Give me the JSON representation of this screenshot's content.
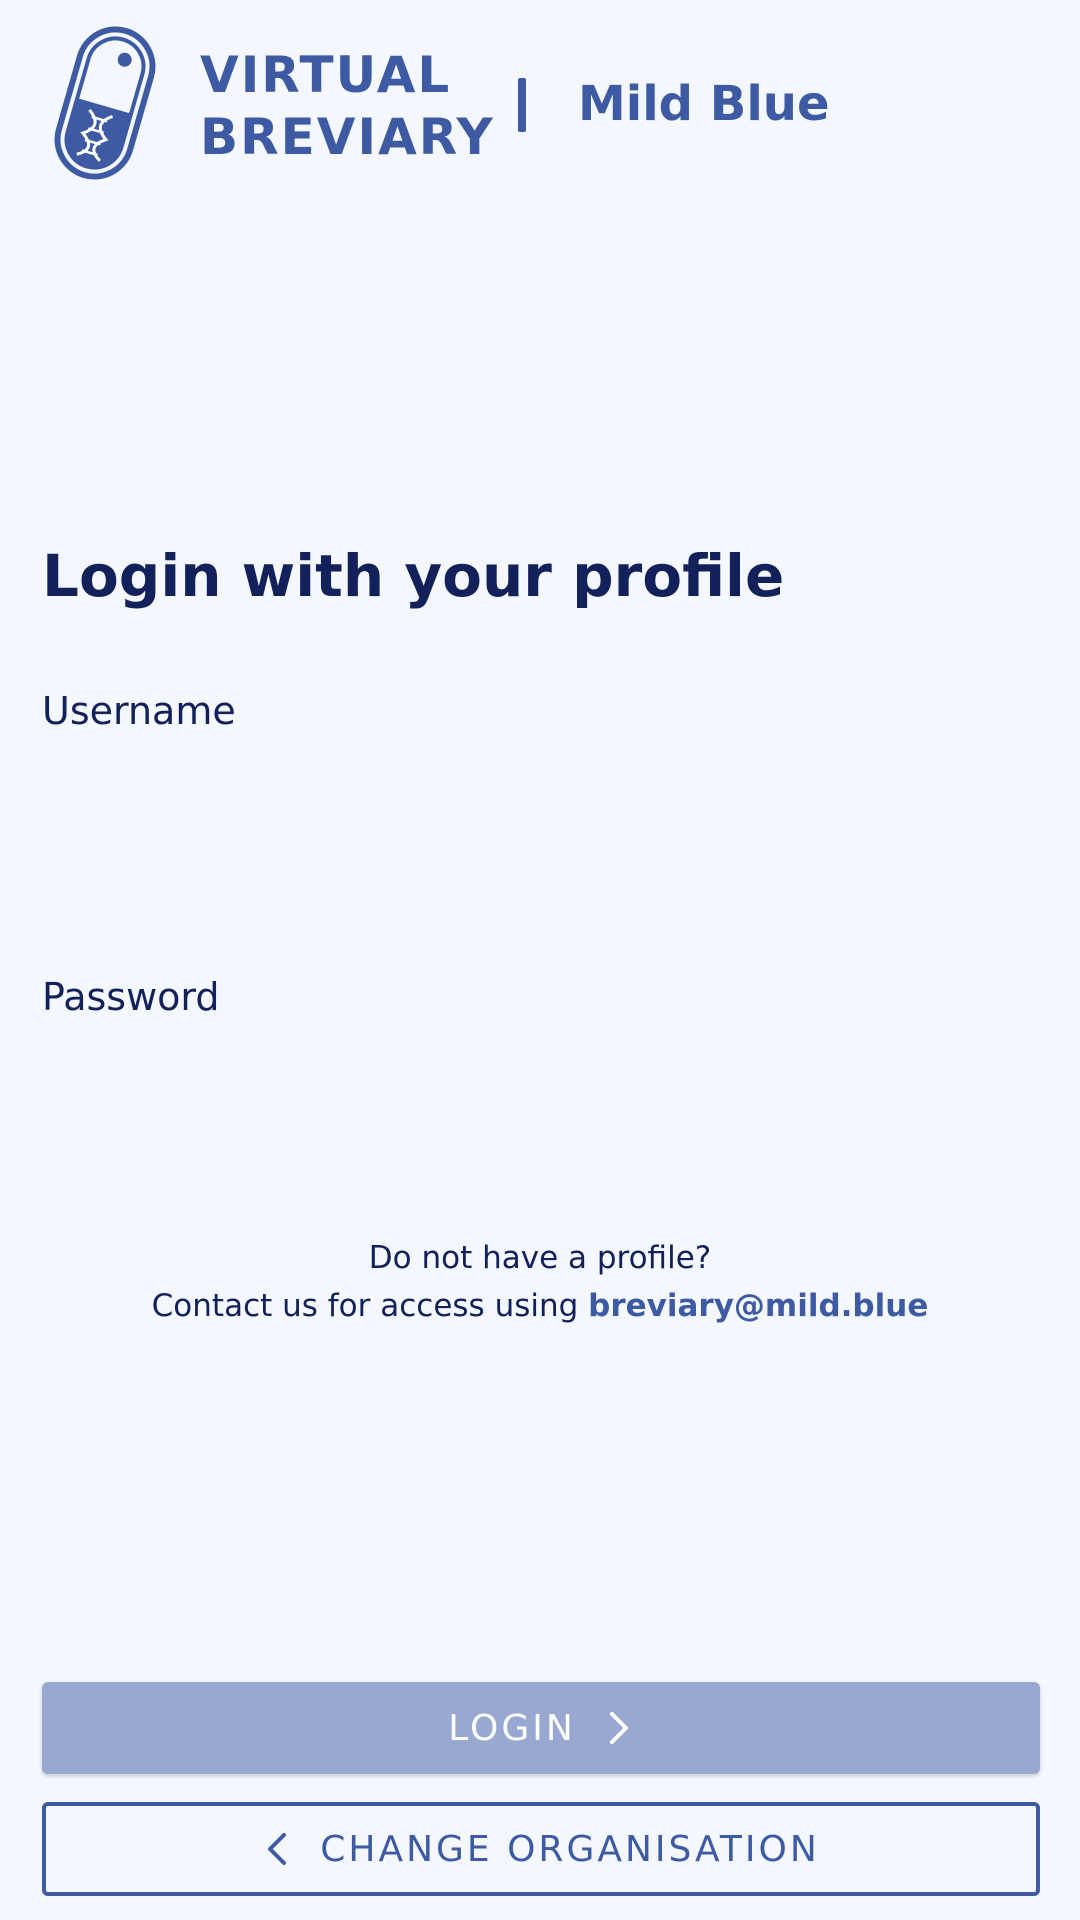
{
  "header": {
    "brand_line1": "VIRTUAL",
    "brand_line2": "BREVIARY",
    "organisation": "Mild Blue",
    "logo_icon": "pill-dna-icon"
  },
  "form": {
    "title": "Login with your profile",
    "username_label": "Username",
    "username_value": "",
    "password_label": "Password",
    "password_value": ""
  },
  "contact": {
    "line1": "Do not have a profile?",
    "line2_prefix": "Contact us for access using ",
    "email": "breviary@mild.blue"
  },
  "buttons": {
    "login_label": "LOGIN",
    "login_icon": "chevron-right-icon",
    "change_org_label": "CHANGE ORGANISATION",
    "change_org_icon": "chevron-left-icon"
  },
  "colors": {
    "background": "#f4f8fe",
    "brand": "#3d5aa3",
    "text": "#13215a",
    "login_disabled": "#98a8d0"
  }
}
